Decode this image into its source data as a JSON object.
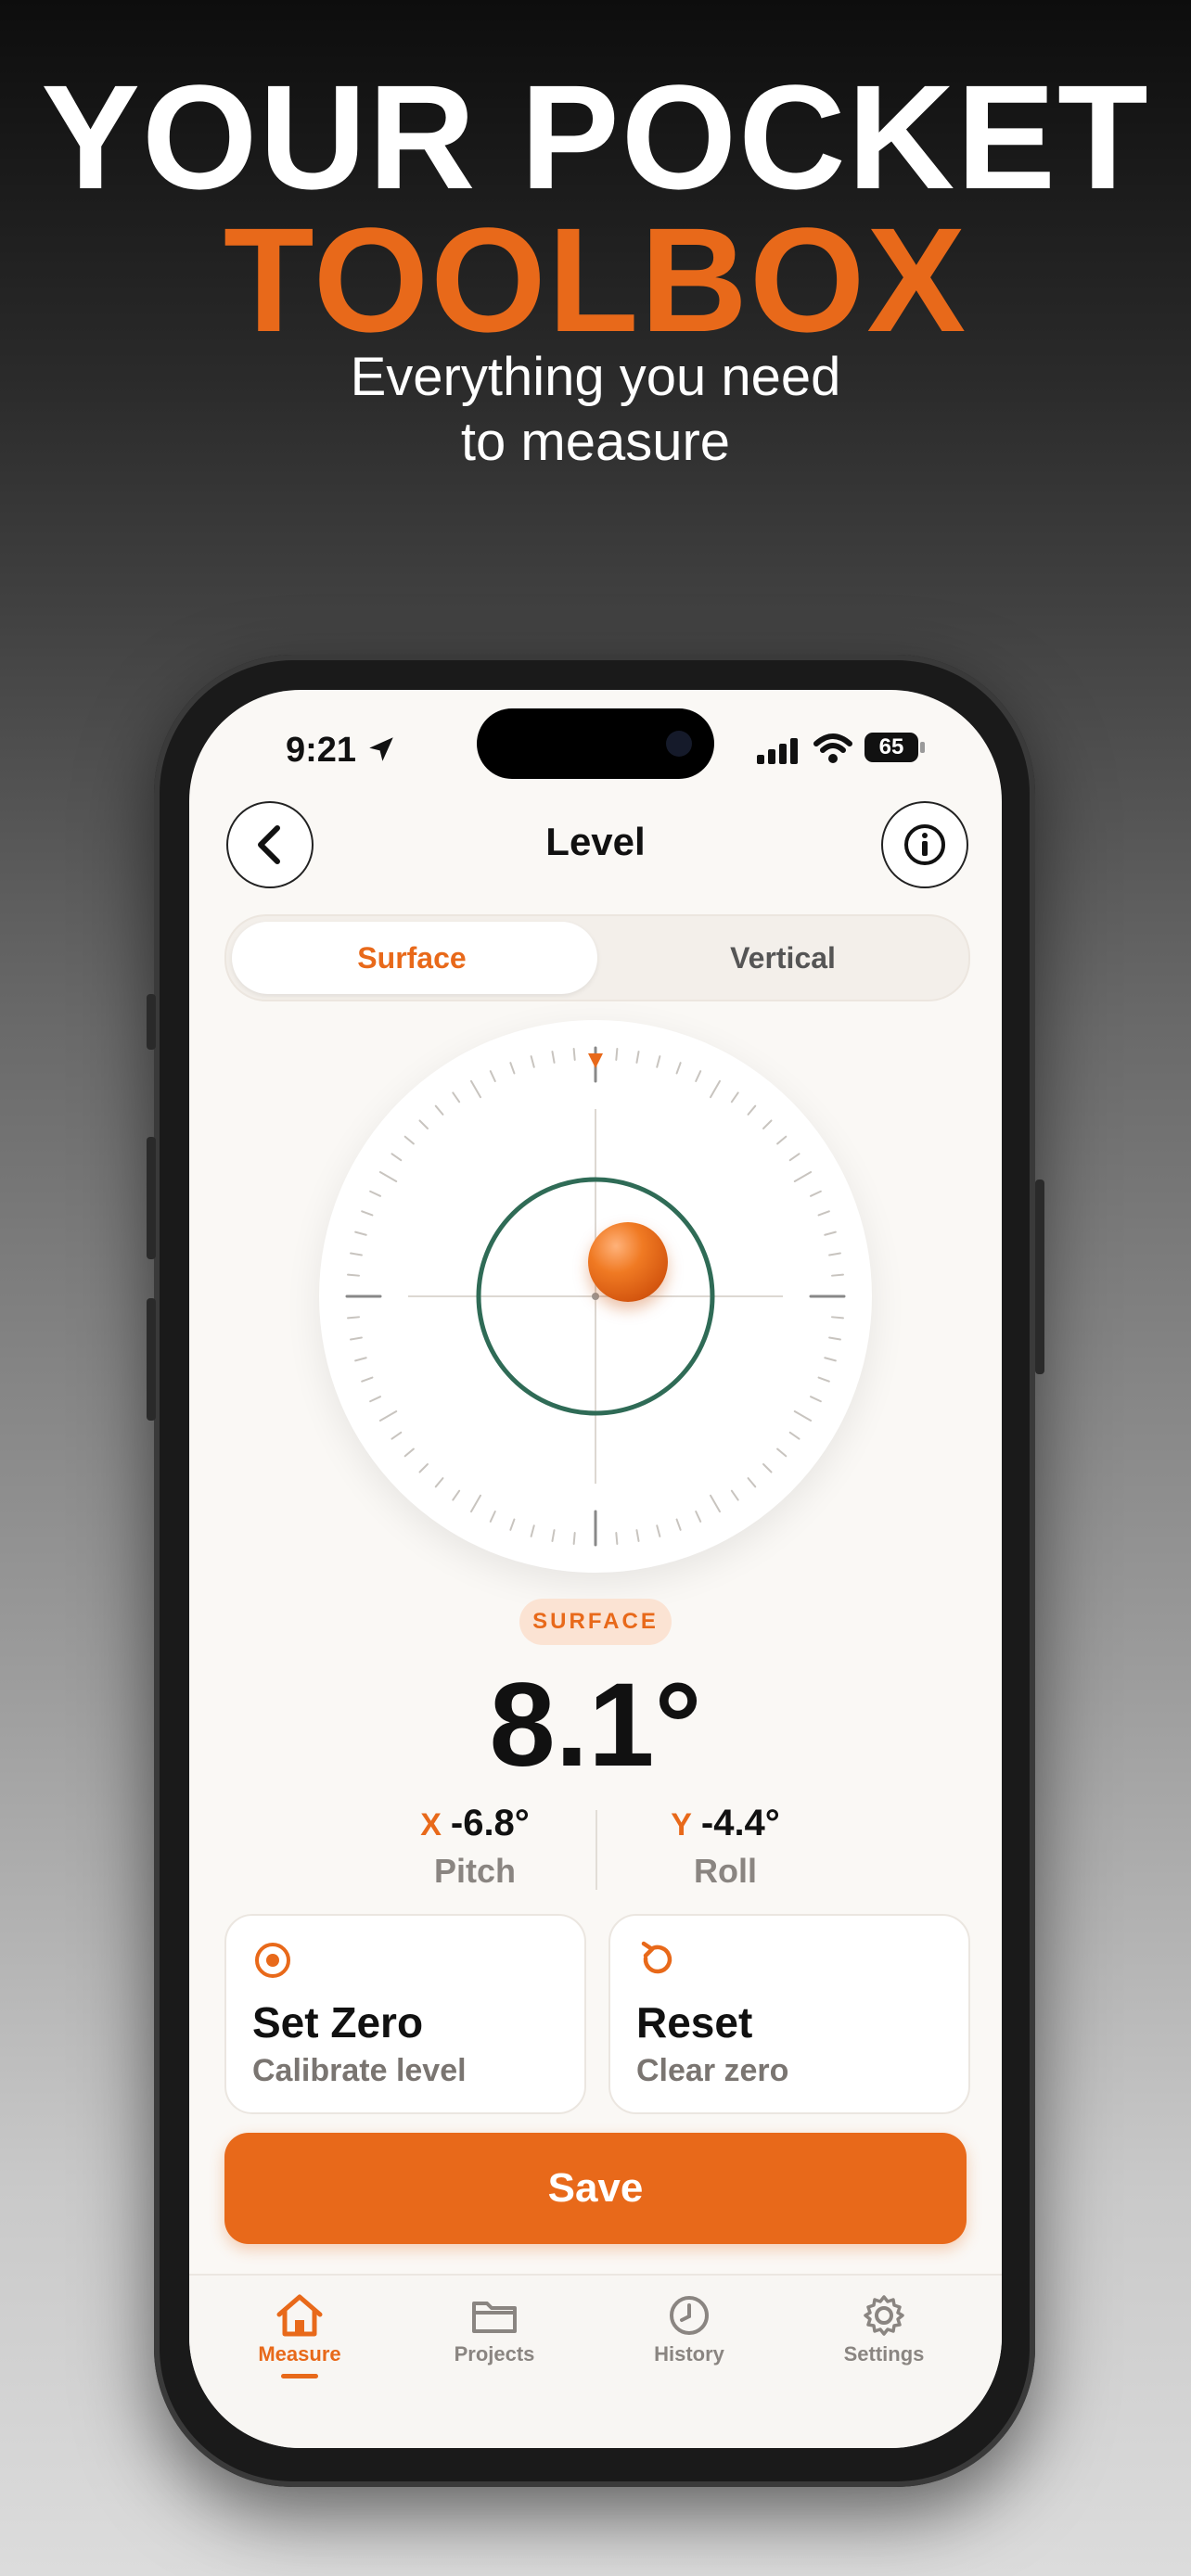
{
  "hero": {
    "line1": "YOUR POCKET",
    "line2": "TOOLBOX",
    "sub_line1": "Everything you need",
    "sub_line2": "to measure"
  },
  "status_bar": {
    "time": "9:21",
    "battery": "65"
  },
  "nav": {
    "title": "Level",
    "back_icon": "chevron-left-icon",
    "info_icon": "info-icon"
  },
  "segment": {
    "options": [
      "Surface",
      "Vertical"
    ],
    "selected": "Surface"
  },
  "reading": {
    "mode_badge": "SURFACE",
    "angle": "8.1°",
    "x_letter": "X",
    "x_value": "-6.8°",
    "x_name": "Pitch",
    "y_letter": "Y",
    "y_value": "-4.4°",
    "y_name": "Roll"
  },
  "actions": {
    "set_zero_title": "Set Zero",
    "set_zero_sub": "Calibrate level",
    "reset_title": "Reset",
    "reset_sub": "Clear zero",
    "save_label": "Save"
  },
  "tabs": [
    {
      "label": "Measure",
      "icon": "home-icon",
      "active": true
    },
    {
      "label": "Projects",
      "icon": "folder-icon",
      "active": false
    },
    {
      "label": "History",
      "icon": "clock-icon",
      "active": false
    },
    {
      "label": "Settings",
      "icon": "gear-icon",
      "active": false
    }
  ],
  "colors": {
    "accent": "#e8691a",
    "bubble_ring": "#2f6b56",
    "background_light": "#faf8f5"
  }
}
